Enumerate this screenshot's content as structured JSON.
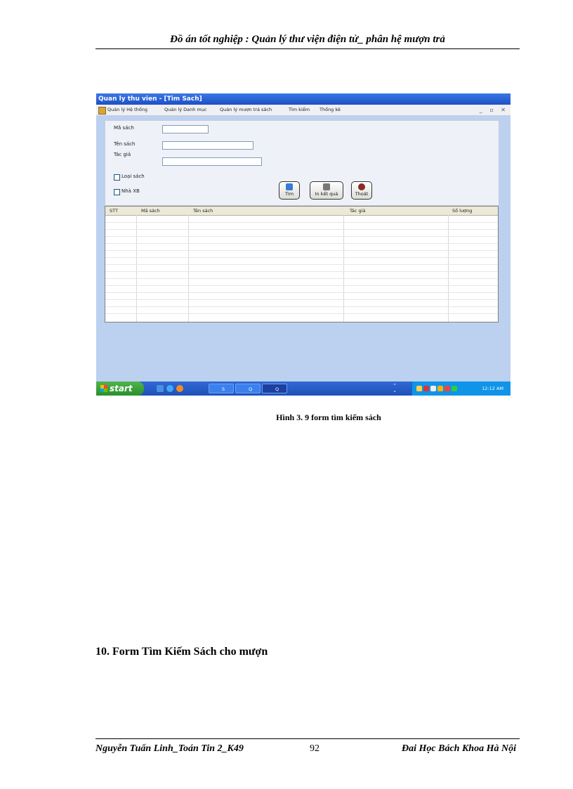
{
  "header": {
    "title": "Đồ án tốt nghiệp : Quản lý thư viện điện tử_ phân hệ mượn trả"
  },
  "screenshot": {
    "window_title": "Quan ly thu vien - [Tim Sach]",
    "menu": [
      "Quản lý Hệ thống",
      "Quản lý Danh mục",
      "Quản lý mượn trả sách",
      "Tìm kiếm",
      "Thống kê"
    ],
    "mdi_controls": "_ ▫ ✕",
    "form": {
      "ma_sach_label": "Mã sách",
      "ten_sach_label": "Tên sách",
      "tac_gia_label": "Tác giả",
      "loai_sach_label": "Loại sách",
      "nha_xb_label": "Nhà XB"
    },
    "buttons": {
      "tim": "Tìm",
      "in_ket_qua": "In kết quả",
      "thoat": "Thoát"
    },
    "grid_columns": [
      "STT",
      "Mã sách",
      "Tên sách",
      "Tác giả",
      "Số lượng"
    ],
    "taskbar": {
      "start_label": "start",
      "tasks": [
        "S",
        "Q",
        "Q"
      ],
      "clock": "12:12 AM"
    }
  },
  "caption": "Hình 3. 9 form tìm kiếm sách",
  "section_heading": "10. Form Tìm Kiếm Sách cho mượn",
  "footer": {
    "left": "Nguyễn Tuấn Linh_Toán Tin 2_K49",
    "page_number": "92",
    "right": "Đai Học Bách Khoa Hà Nội"
  }
}
